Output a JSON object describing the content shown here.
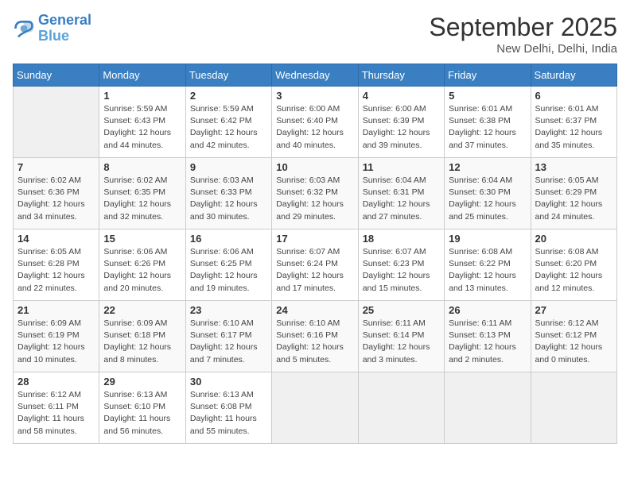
{
  "logo": {
    "line1": "General",
    "line2": "Blue"
  },
  "title": "September 2025",
  "location": "New Delhi, Delhi, India",
  "weekdays": [
    "Sunday",
    "Monday",
    "Tuesday",
    "Wednesday",
    "Thursday",
    "Friday",
    "Saturday"
  ],
  "weeks": [
    [
      {
        "day": "",
        "info": ""
      },
      {
        "day": "1",
        "info": "Sunrise: 5:59 AM\nSunset: 6:43 PM\nDaylight: 12 hours\nand 44 minutes."
      },
      {
        "day": "2",
        "info": "Sunrise: 5:59 AM\nSunset: 6:42 PM\nDaylight: 12 hours\nand 42 minutes."
      },
      {
        "day": "3",
        "info": "Sunrise: 6:00 AM\nSunset: 6:40 PM\nDaylight: 12 hours\nand 40 minutes."
      },
      {
        "day": "4",
        "info": "Sunrise: 6:00 AM\nSunset: 6:39 PM\nDaylight: 12 hours\nand 39 minutes."
      },
      {
        "day": "5",
        "info": "Sunrise: 6:01 AM\nSunset: 6:38 PM\nDaylight: 12 hours\nand 37 minutes."
      },
      {
        "day": "6",
        "info": "Sunrise: 6:01 AM\nSunset: 6:37 PM\nDaylight: 12 hours\nand 35 minutes."
      }
    ],
    [
      {
        "day": "7",
        "info": "Sunrise: 6:02 AM\nSunset: 6:36 PM\nDaylight: 12 hours\nand 34 minutes."
      },
      {
        "day": "8",
        "info": "Sunrise: 6:02 AM\nSunset: 6:35 PM\nDaylight: 12 hours\nand 32 minutes."
      },
      {
        "day": "9",
        "info": "Sunrise: 6:03 AM\nSunset: 6:33 PM\nDaylight: 12 hours\nand 30 minutes."
      },
      {
        "day": "10",
        "info": "Sunrise: 6:03 AM\nSunset: 6:32 PM\nDaylight: 12 hours\nand 29 minutes."
      },
      {
        "day": "11",
        "info": "Sunrise: 6:04 AM\nSunset: 6:31 PM\nDaylight: 12 hours\nand 27 minutes."
      },
      {
        "day": "12",
        "info": "Sunrise: 6:04 AM\nSunset: 6:30 PM\nDaylight: 12 hours\nand 25 minutes."
      },
      {
        "day": "13",
        "info": "Sunrise: 6:05 AM\nSunset: 6:29 PM\nDaylight: 12 hours\nand 24 minutes."
      }
    ],
    [
      {
        "day": "14",
        "info": "Sunrise: 6:05 AM\nSunset: 6:28 PM\nDaylight: 12 hours\nand 22 minutes."
      },
      {
        "day": "15",
        "info": "Sunrise: 6:06 AM\nSunset: 6:26 PM\nDaylight: 12 hours\nand 20 minutes."
      },
      {
        "day": "16",
        "info": "Sunrise: 6:06 AM\nSunset: 6:25 PM\nDaylight: 12 hours\nand 19 minutes."
      },
      {
        "day": "17",
        "info": "Sunrise: 6:07 AM\nSunset: 6:24 PM\nDaylight: 12 hours\nand 17 minutes."
      },
      {
        "day": "18",
        "info": "Sunrise: 6:07 AM\nSunset: 6:23 PM\nDaylight: 12 hours\nand 15 minutes."
      },
      {
        "day": "19",
        "info": "Sunrise: 6:08 AM\nSunset: 6:22 PM\nDaylight: 12 hours\nand 13 minutes."
      },
      {
        "day": "20",
        "info": "Sunrise: 6:08 AM\nSunset: 6:20 PM\nDaylight: 12 hours\nand 12 minutes."
      }
    ],
    [
      {
        "day": "21",
        "info": "Sunrise: 6:09 AM\nSunset: 6:19 PM\nDaylight: 12 hours\nand 10 minutes."
      },
      {
        "day": "22",
        "info": "Sunrise: 6:09 AM\nSunset: 6:18 PM\nDaylight: 12 hours\nand 8 minutes."
      },
      {
        "day": "23",
        "info": "Sunrise: 6:10 AM\nSunset: 6:17 PM\nDaylight: 12 hours\nand 7 minutes."
      },
      {
        "day": "24",
        "info": "Sunrise: 6:10 AM\nSunset: 6:16 PM\nDaylight: 12 hours\nand 5 minutes."
      },
      {
        "day": "25",
        "info": "Sunrise: 6:11 AM\nSunset: 6:14 PM\nDaylight: 12 hours\nand 3 minutes."
      },
      {
        "day": "26",
        "info": "Sunrise: 6:11 AM\nSunset: 6:13 PM\nDaylight: 12 hours\nand 2 minutes."
      },
      {
        "day": "27",
        "info": "Sunrise: 6:12 AM\nSunset: 6:12 PM\nDaylight: 12 hours\nand 0 minutes."
      }
    ],
    [
      {
        "day": "28",
        "info": "Sunrise: 6:12 AM\nSunset: 6:11 PM\nDaylight: 11 hours\nand 58 minutes."
      },
      {
        "day": "29",
        "info": "Sunrise: 6:13 AM\nSunset: 6:10 PM\nDaylight: 11 hours\nand 56 minutes."
      },
      {
        "day": "30",
        "info": "Sunrise: 6:13 AM\nSunset: 6:08 PM\nDaylight: 11 hours\nand 55 minutes."
      },
      {
        "day": "",
        "info": ""
      },
      {
        "day": "",
        "info": ""
      },
      {
        "day": "",
        "info": ""
      },
      {
        "day": "",
        "info": ""
      }
    ]
  ]
}
